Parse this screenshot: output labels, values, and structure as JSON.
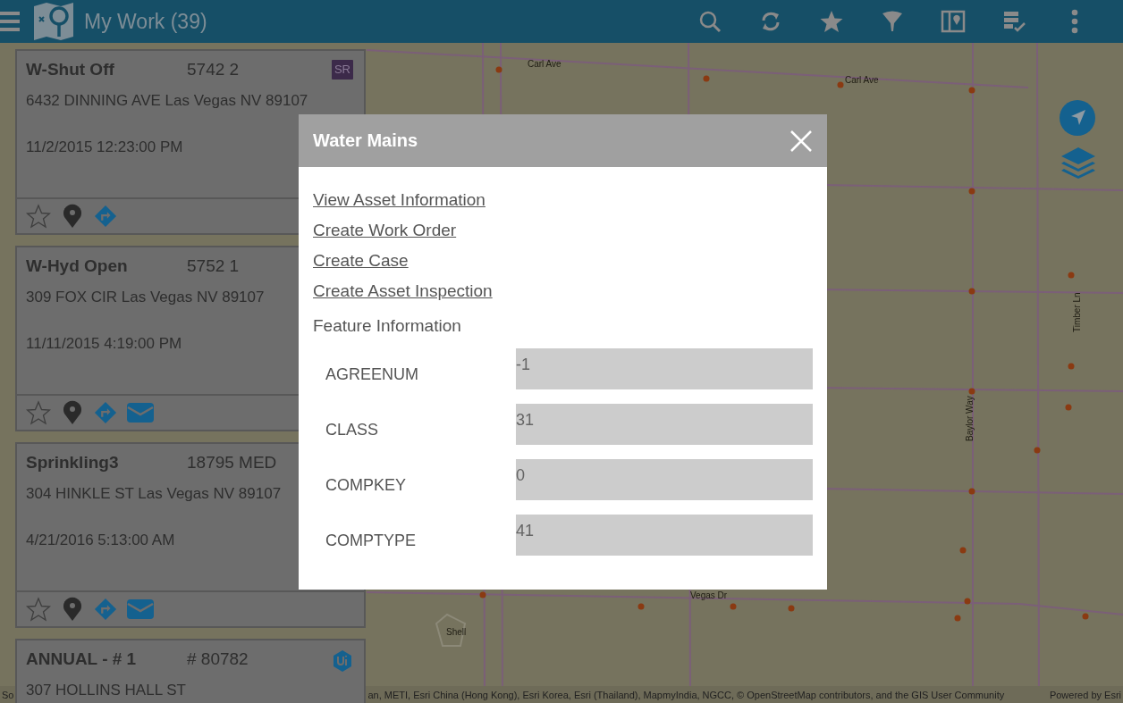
{
  "header": {
    "title": "My Work (39)",
    "actions": [
      {
        "kind": "search"
      },
      {
        "kind": "refresh"
      },
      {
        "kind": "favorites"
      },
      {
        "kind": "filter"
      },
      {
        "kind": "map-view"
      },
      {
        "kind": "checklist"
      },
      {
        "kind": "more"
      }
    ]
  },
  "map": {
    "labels": [
      {
        "text": "Carl Ave",
        "kind": "street"
      },
      {
        "text": "Carl Ave",
        "kind": "street"
      },
      {
        "text": "Vegas Dr",
        "kind": "street"
      },
      {
        "text": "Shell",
        "kind": "poi"
      },
      {
        "text": "Timber Ln",
        "kind": "vertical"
      },
      {
        "text": "Baylor Way",
        "kind": "vertical"
      }
    ],
    "controls": [
      {
        "kind": "locate"
      },
      {
        "kind": "layers"
      }
    ]
  },
  "work_items": [
    {
      "title": "W-Shut Off",
      "number": "5742 2",
      "address": "6432 DINNING AVE Las Vegas NV 89107",
      "date": "11/2/2015 12:23:00 PM",
      "badge": {
        "kind": "sr",
        "text": "SR"
      },
      "favorite": false,
      "actions": [
        {
          "kind": "pin"
        },
        {
          "kind": "directions"
        }
      ]
    },
    {
      "title": "W-Hyd Open",
      "number": "5752 1",
      "address": "309 FOX CIR Las Vegas NV 89107",
      "date": "11/11/2015 4:19:00 PM",
      "favorite": false,
      "actions": [
        {
          "kind": "pin"
        },
        {
          "kind": "directions"
        },
        {
          "kind": "mail"
        }
      ]
    },
    {
      "title": "Sprinkling3",
      "number": "18795 MED",
      "address": "304 HINKLE ST Las Vegas NV 89107",
      "date": "4/21/2016 5:13:00 AM",
      "favorite": false,
      "actions": [
        {
          "kind": "pin"
        },
        {
          "kind": "directions"
        },
        {
          "kind": "mail"
        }
      ]
    },
    {
      "title": "ANNUAL - # 1",
      "number": "# 80782",
      "address": "307 HOLLINS HALL ST",
      "badge": {
        "kind": "ui"
      }
    }
  ],
  "attribution": {
    "left": "So",
    "text": "an, METI, Esri China (Hong Kong), Esri Korea, Esri (Thailand), MapmyIndia, NGCC, © OpenStreetMap contributors, and the GIS User Community",
    "powered": "Powered by Esri"
  },
  "dialog": {
    "title": "Water Mains",
    "links": [
      "View Asset Information",
      "Create Work Order",
      "Create Case",
      "Create Asset Inspection"
    ],
    "section": "Feature Information",
    "fields": [
      {
        "label": "AGREENUM",
        "value": "-1"
      },
      {
        "label": "CLASS",
        "value": "31"
      },
      {
        "label": "COMPKEY",
        "value": "0"
      },
      {
        "label": "COMPTYPE",
        "value": "41"
      }
    ]
  }
}
